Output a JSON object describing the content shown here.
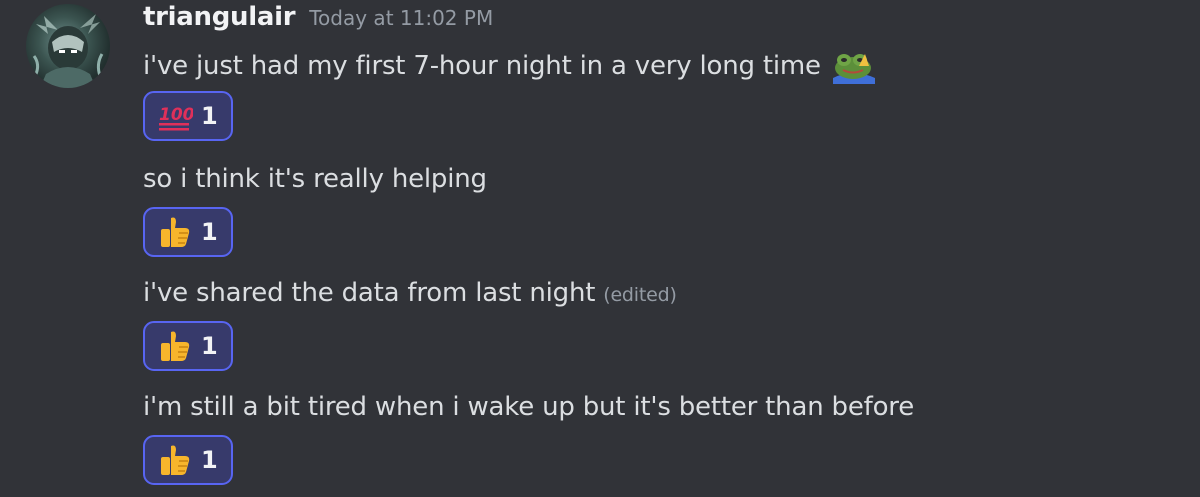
{
  "message": {
    "username": "triangulair",
    "timestamp": "Today at 11:02 PM",
    "avatar_icon": "dark-character-avatar",
    "lines": [
      {
        "text": "i've just had my first 7-hour night in a very long time",
        "inline_emoji": "praying-frog-emoji",
        "reaction": {
          "emoji": "hundred-points-emoji",
          "count": "1"
        }
      },
      {
        "text": "so i think it's really helping",
        "reaction": {
          "emoji": "thumbs-up-emoji",
          "count": "1"
        }
      },
      {
        "text": "i've shared the data from last night",
        "edited": "(edited)",
        "reaction": {
          "emoji": "thumbs-up-emoji",
          "count": "1"
        }
      },
      {
        "text": "i'm still a bit tired when i wake up but it's better than before",
        "reaction": {
          "emoji": "thumbs-up-emoji",
          "count": "1"
        }
      }
    ]
  },
  "colors": {
    "background": "#313338",
    "text": "#dbdee1",
    "username": "#f2f3f5",
    "muted": "#949ba4",
    "reaction_border": "#5865f2",
    "reaction_bg": "#373a6b",
    "hundred_red": "#e0305a",
    "thumb_yellow": "#f7b52c"
  }
}
